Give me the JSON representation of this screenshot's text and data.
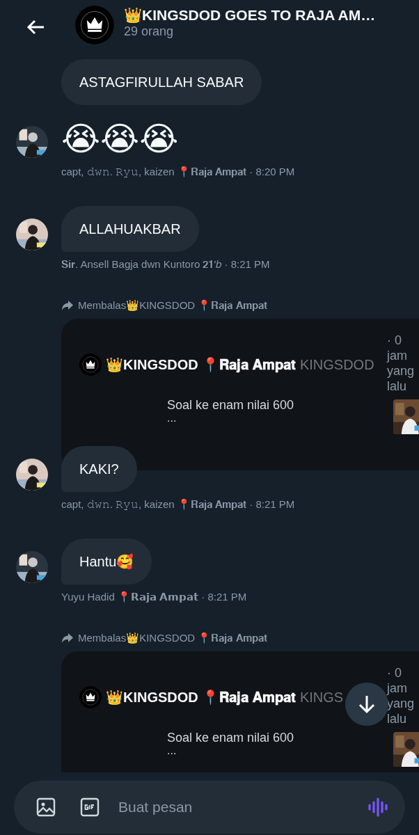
{
  "header": {
    "title": "👑KINGSDOD GOES TO RAJA AM…",
    "subtitle": "29 orang"
  },
  "messages": [
    {
      "kind": "text",
      "avatar": false,
      "text": "ASTAGFIRULLAH SABAR"
    },
    {
      "kind": "emoji",
      "avatar": true,
      "text": "😭😭😭",
      "meta": "capt, 𝚍𝚠𝚗. 𝚁𝚢𝚞, kaizen 📍𝐑𝐚𝐣𝐚 𝐀𝐦𝐩𝐚𝐭 · 8:20 PM"
    },
    {
      "kind": "text",
      "avatar": true,
      "text": "ALLAHUAKBAR",
      "meta": "𝐒𝐢𝐫. Ansell Bagja dwn Kuntoro 𝟐𝟏'𝑏 · 8:21 PM"
    },
    {
      "kind": "text",
      "avatar": true,
      "reply": {
        "label": "Membalas👑KINGSDOD 📍𝐑𝐚𝐣𝐚 𝐀𝐦𝐩𝐚𝐭",
        "author": "👑KINGSDOD 📍𝐑𝐚𝐣𝐚 𝐀𝐦𝐩𝐚𝐭",
        "handle": "KINGSDOD",
        "time": "· 0 jam yang lalu",
        "body": "Soal ke enam nilai 600",
        "more": "..."
      },
      "text": "KAKI?",
      "meta": "capt, 𝚍𝚠𝚗. 𝚁𝚢𝚞, kaizen 📍𝐑𝐚𝐣𝐚 𝐀𝐦𝐩𝐚𝐭 · 8:21 PM"
    },
    {
      "kind": "text",
      "avatar": true,
      "text": "Hantu🥰",
      "meta": "Yuyu Hadid 📍𝗥𝗮𝗷𝗮 𝗔𝗺𝗽𝗮𝘁 · 8:21 PM"
    },
    {
      "kind": "quote",
      "reply": {
        "label": "Membalas👑KINGSDOD 📍𝐑𝐚𝐣𝐚 𝐀𝐦𝐩𝐚𝐭",
        "author": "👑KINGSDOD 📍𝐑𝐚𝐣𝐚 𝐀𝐦𝐩𝐚𝐭",
        "handle": "KINGS",
        "time": "· 0 jam yang lalu",
        "body": "Soal ke enam nilai 600",
        "more": "..."
      }
    }
  ],
  "composer": {
    "placeholder": "Buat pesan"
  }
}
